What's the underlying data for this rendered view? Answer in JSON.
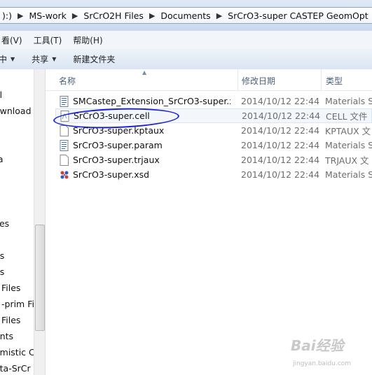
{
  "breadcrumbs": [
    "):)",
    "MS-work",
    "SrCrO2H Files",
    "Documents",
    "SrCrO3-super CASTEP GeomOpt"
  ],
  "menu": [
    "看(V)",
    "工具(T)",
    "帮助(H)"
  ],
  "toolbar": {
    "include": "中",
    "share": "共享",
    "new_folder": "新建文件夹"
  },
  "nav_items": [
    "al",
    "ownload",
    "ta",
    "iles",
    "es",
    "es",
    "Files",
    "-prim Fil",
    "Files",
    "ents",
    "omistic C",
    "ata-SrCr"
  ],
  "columns": {
    "name": "名称",
    "date": "修改日期",
    "type": "类型"
  },
  "files": [
    {
      "name": "SMCastep_Extension_SrCrO3-super.x...",
      "date": "2014/10/12 22:44",
      "type": "Materials S",
      "icon": "document-icon"
    },
    {
      "name": "SrCrO3-super.cell",
      "date": "2014/10/12 22:44",
      "type": "CELL 文件",
      "icon": "cell-file-icon"
    },
    {
      "name": "SrCrO3-super.kptaux",
      "date": "2014/10/12 22:44",
      "type": "KPTAUX 文",
      "icon": "blank-file-icon"
    },
    {
      "name": "SrCrO3-super.param",
      "date": "2014/10/12 22:44",
      "type": "Materials S",
      "icon": "document-icon"
    },
    {
      "name": "SrCrO3-super.trjaux",
      "date": "2014/10/12 22:44",
      "type": "TRJAUX 文",
      "icon": "blank-file-icon"
    },
    {
      "name": "SrCrO3-super.xsd",
      "date": "2014/10/12 22:44",
      "type": "Materials S",
      "icon": "molecule-icon"
    }
  ],
  "watermark": {
    "brand": "Bai经验",
    "url": "jingyan.baidu.com"
  }
}
